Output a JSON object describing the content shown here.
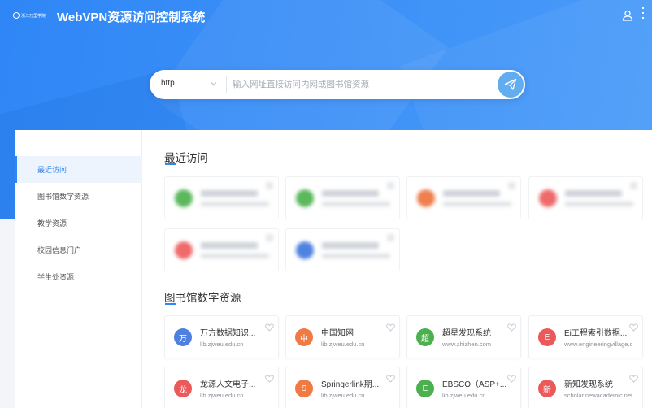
{
  "header": {
    "logo_text": "浙江万里学院",
    "title": "WebVPN资源访问控制系统"
  },
  "search": {
    "protocol": "http",
    "placeholder": "输入网址直接访问内网或图书馆资源"
  },
  "sidebar": {
    "items": [
      {
        "label": "最近访问",
        "active": true
      },
      {
        "label": "图书馆数字资源",
        "active": false
      },
      {
        "label": "教学资源",
        "active": false
      },
      {
        "label": "校园信息门户",
        "active": false
      },
      {
        "label": "学生处资源",
        "active": false
      }
    ]
  },
  "recent": {
    "title": "最近访问",
    "items": [
      {
        "icon_color": "#5cb85c"
      },
      {
        "icon_color": "#5cb85c"
      },
      {
        "icon_color": "#f07f4e"
      },
      {
        "icon_color": "#ef6a6a"
      },
      {
        "icon_color": "#ef6a6a"
      },
      {
        "icon_color": "#4f83e0"
      }
    ]
  },
  "library": {
    "title": "图书馆数字资源",
    "items": [
      {
        "icon_char": "万",
        "icon_color": "#4f7fe0",
        "name": "万方数据知识...",
        "url": "lib.zjweu.edu.cn"
      },
      {
        "icon_char": "中",
        "icon_color": "#f07a44",
        "name": "中国知网",
        "url": "lib.zjweu.edu.cn"
      },
      {
        "icon_char": "超",
        "icon_color": "#4cb050",
        "name": "超星发现系统",
        "url": "www.zhizhen.com"
      },
      {
        "icon_char": "E",
        "icon_color": "#ea5a5a",
        "name": "Ei工程索引数据...",
        "url": "www.engineeringvillage.c"
      },
      {
        "icon_char": "龙",
        "icon_color": "#ea5a5a",
        "name": "龙源人文电子...",
        "url": "lib.zjweu.edu.cn"
      },
      {
        "icon_char": "S",
        "icon_color": "#f07a44",
        "name": "Springerlink期...",
        "url": "lib.zjweu.edu.cn"
      },
      {
        "icon_char": "E",
        "icon_color": "#4cb050",
        "name": "EBSCO（ASP+...",
        "url": "lib.zjweu.edu.cn"
      },
      {
        "icon_char": "新",
        "icon_color": "#ea5a5a",
        "name": "新知发现系统",
        "url": "scholar.newacademic.net"
      }
    ]
  },
  "colors": {
    "brand": "#2f86f6",
    "background": "#f3f5f8"
  }
}
